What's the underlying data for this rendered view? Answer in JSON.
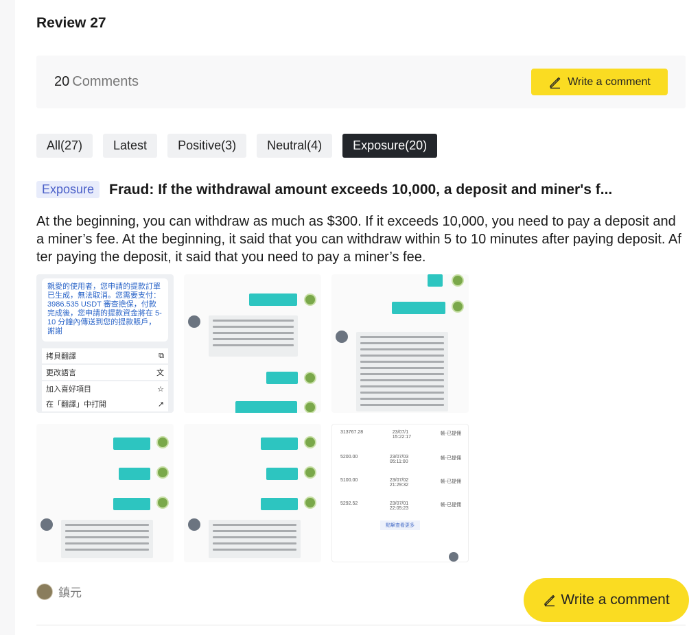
{
  "page": {
    "title": "Review 27"
  },
  "comments_bar": {
    "count": "20",
    "label": "Comments",
    "write_button": "Write a comment",
    "pencil_icon": "pencil-icon"
  },
  "filters": [
    {
      "label": "All(27)",
      "active": false
    },
    {
      "label": "Latest",
      "active": false
    },
    {
      "label": "Positive(3)",
      "active": false
    },
    {
      "label": "Neutral(4)",
      "active": false
    },
    {
      "label": "Exposure(20)",
      "active": true
    }
  ],
  "review": {
    "badge": "Exposure",
    "title": "Fraud: If the withdrawal amount exceeds 10,000, a deposit and miner's f...",
    "body": "At the beginning, you can withdraw as much as $300. If it exceeds 10,000, you need to pay a deposit and a miner’s fee. At the beginning, it said that you can withdraw within 5 to 10 minutes after paying deposit. After paying the deposit, it said that you need to pay a miner’s fee.",
    "screenshot1": {
      "card_text": "親愛的使用者，您申請的提款訂單已生成，無法取消。您需要支付：3986.535 USDT 審查擔保，付款完成後，您申請的提款資金將在 5-10 分鐘內傳送到您的提款賬戶，謝謝",
      "menu": [
        {
          "label": "拷貝翻譯",
          "icon": "copy-icon"
        },
        {
          "label": "更改語言",
          "icon": "translate-icon"
        },
        {
          "label": "加入喜好項目",
          "icon": "star-icon"
        },
        {
          "label": "在「翻譯」中打開",
          "icon": "open-external-icon"
        }
      ]
    },
    "screenshot6": {
      "rows": [
        {
          "amount": "313767.28",
          "date": "23/07/1",
          "time": "15:22:17",
          "status": "帳-已提佣"
        },
        {
          "amount": "5200.00",
          "date": "23/07/03",
          "time": "05:11:00",
          "status": "帳-已提佣"
        },
        {
          "amount": "5100.00",
          "date": "23/07/02",
          "time": "21:29:32",
          "status": "帳-已提佣"
        },
        {
          "amount": "5292.52",
          "date": "23/07/01",
          "time": "22:05:23",
          "status": "帳-已提佣"
        }
      ],
      "button": "點擊查看更多"
    }
  },
  "user": {
    "name": "鎮元"
  },
  "float_button": {
    "label": "Write a comment"
  }
}
